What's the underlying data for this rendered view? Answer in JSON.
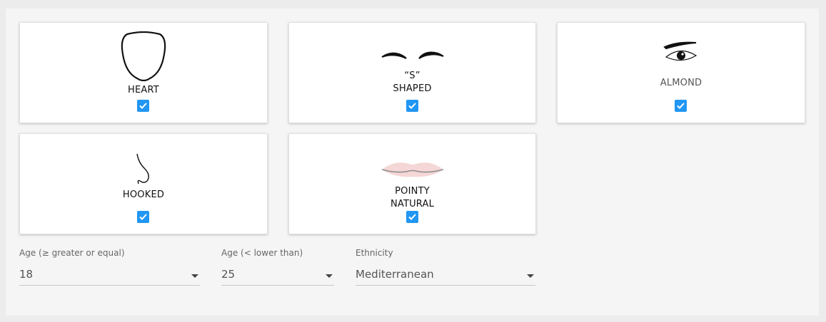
{
  "features": [
    {
      "id": "face",
      "lines": [
        "HEART",
        ""
      ],
      "icon": "heart-face-shape-icon",
      "checked": true
    },
    {
      "id": "brows",
      "lines": [
        "“S”",
        "SHAPED"
      ],
      "icon": "s-shaped-eyebrows-icon",
      "checked": true
    },
    {
      "id": "eyes",
      "lines": [
        "ALMOND",
        ""
      ],
      "icon": "almond-eye-icon",
      "checked": true
    },
    {
      "id": "nose",
      "lines": [
        "HOOKED",
        ""
      ],
      "icon": "hooked-nose-icon",
      "checked": true
    },
    {
      "id": "lips",
      "lines": [
        "POINTY",
        "NATURAL"
      ],
      "icon": "pointy-natural-lips-icon",
      "checked": true
    }
  ],
  "filters": {
    "age_min": {
      "label": "Age (≥ greater or equal)",
      "value": "18"
    },
    "age_max": {
      "label": "Age (< lower than)",
      "value": "25"
    },
    "ethnicity": {
      "label": "Ethnicity",
      "value": "Mediterranean"
    }
  },
  "colors": {
    "checkbox": "#2196f3",
    "lips": "#f4d7d6"
  }
}
